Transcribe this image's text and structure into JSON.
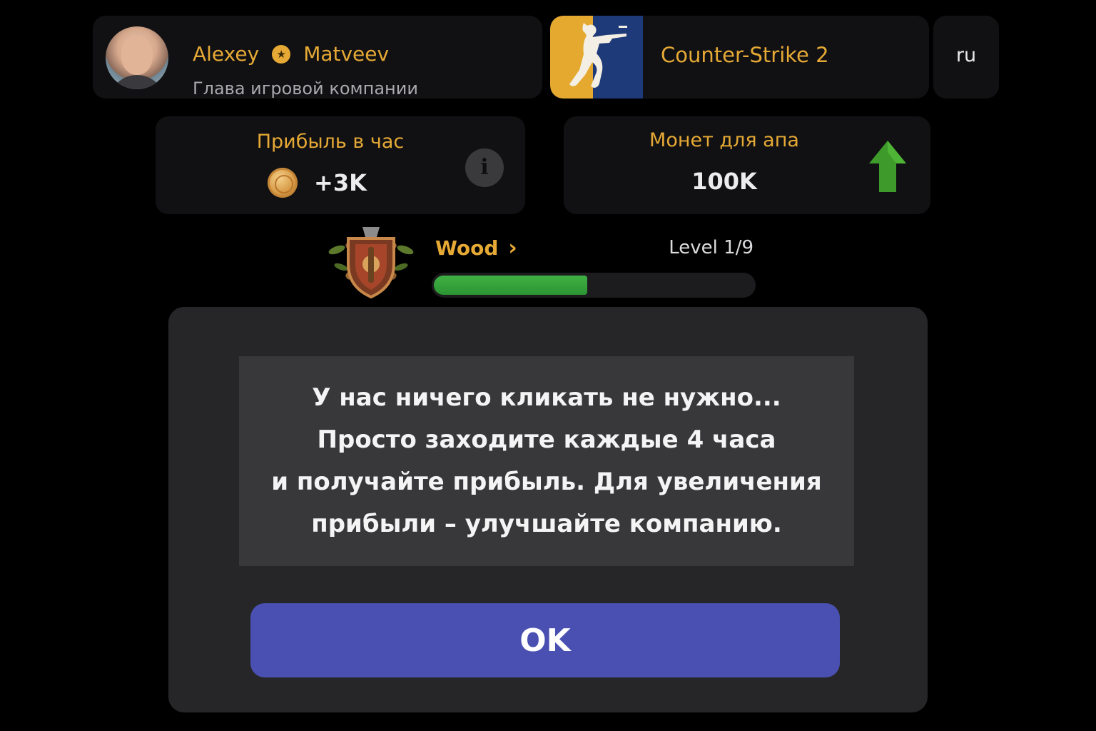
{
  "profile": {
    "first_name": "Alexey",
    "last_name": "Matveev",
    "role": "Глава игровой компании",
    "badge_icon": "star-icon"
  },
  "game": {
    "title": "Counter-Strike 2",
    "logo_icon": "counter-strike-logo-icon"
  },
  "language": {
    "label": "ru"
  },
  "stats": {
    "profit": {
      "title": "Прибыль в час",
      "value": "+3K",
      "icon": "coin-icon",
      "info_icon": "info-icon"
    },
    "upgrade": {
      "title": "Монет для апа",
      "value": "100K",
      "icon": "arrow-up-icon"
    }
  },
  "level": {
    "league": "Wood",
    "label": "Level 1/9",
    "progress_fraction": 0.48,
    "emblem_icon": "wood-league-emblem-icon"
  },
  "modal": {
    "message": "У нас ничего кликать не нужно...\nПросто заходите каждые 4 часа\nи получайте прибыль. Для увеличения\nприбыли – улучшайте компанию.",
    "ok_label": "OK"
  },
  "colors": {
    "accent": "#e6a935",
    "card": "#111113",
    "modal": "#262628",
    "button": "#4a50b1",
    "progress": "#3fb043"
  }
}
